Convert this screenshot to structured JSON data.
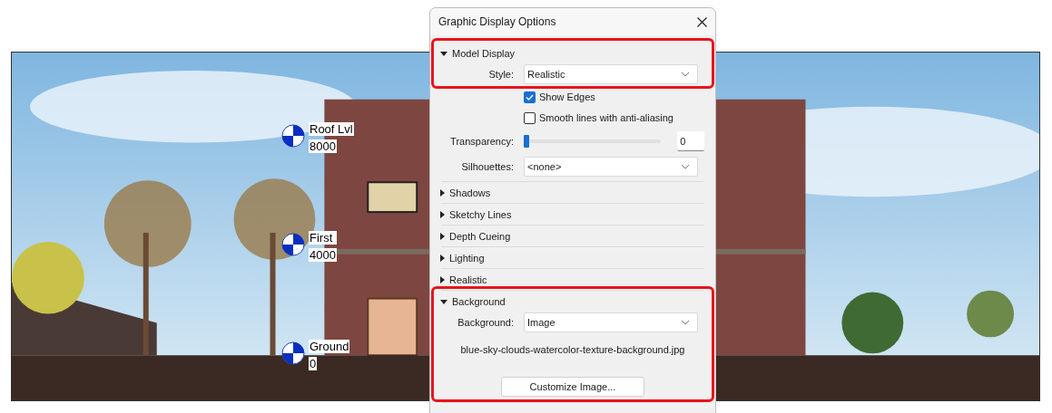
{
  "viewport": {
    "levels": [
      {
        "name": "Roof Lvl",
        "elevation": "8000"
      },
      {
        "name": "First",
        "elevation": "4000"
      },
      {
        "name": "Ground",
        "elevation": "0"
      }
    ]
  },
  "dialog": {
    "title": "Graphic Display Options",
    "sections": [
      {
        "title": "Model Display",
        "expanded": true,
        "rows": [
          {
            "kind": "select",
            "label": "Style:",
            "value": "Realistic",
            "highlighted": true
          },
          {
            "kind": "checkbox",
            "label": "Show Edges",
            "checked": true,
            "highlighted": false
          },
          {
            "kind": "checkbox",
            "label": "Smooth lines with anti-aliasing",
            "checked": false,
            "highlighted": false
          },
          {
            "kind": "slider",
            "label": "Transparency:",
            "level": 0,
            "value": "0",
            "highlighted": false
          },
          {
            "kind": "select",
            "label": "Silhouettes:",
            "value": "<none>",
            "highlighted": false
          }
        ]
      },
      {
        "title": "Shadows",
        "expanded": false
      },
      {
        "title": "Sketchy Lines",
        "expanded": false
      },
      {
        "title": "Depth Cueing",
        "expanded": false
      },
      {
        "title": "Lighting",
        "expanded": false
      },
      {
        "title": "Realistic",
        "expanded": false
      },
      {
        "title": "Background",
        "expanded": true,
        "rows": [
          {
            "kind": "select",
            "label": "Background:",
            "value": "Image",
            "highlighted": true
          },
          {
            "kind": "note",
            "text": "blue-sky-clouds-watercolor-texture-background.jpg",
            "highlighted": true
          },
          {
            "kind": "button",
            "label": "Customize Image...",
            "highlighted": true
          }
        ]
      }
    ]
  }
}
